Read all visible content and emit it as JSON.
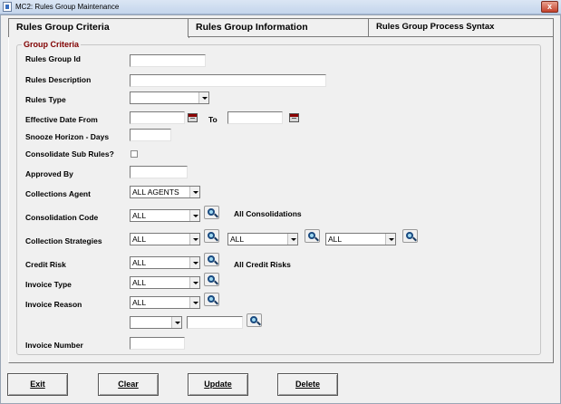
{
  "window": {
    "title": "MC2: Rules Group Maintenance",
    "close_label": "x"
  },
  "tabs": [
    {
      "label": "Rules Group Criteria",
      "active": true
    },
    {
      "label": "Rules Group Information",
      "active": false
    },
    {
      "label": "Rules Group Process Syntax",
      "active": false
    }
  ],
  "group": {
    "label": "Group Criteria"
  },
  "fields": {
    "rules_group_id": {
      "label": "Rules Group Id",
      "value": ""
    },
    "rules_description": {
      "label": "Rules Description",
      "value": ""
    },
    "rules_type": {
      "label": "Rules Type",
      "value": ""
    },
    "effective_date": {
      "label": "Effective Date From",
      "to_label": "To",
      "from_value": "",
      "to_value": ""
    },
    "snooze": {
      "label": "Snooze Horizon - Days",
      "value": ""
    },
    "consolidate": {
      "label": "Consolidate Sub Rules?",
      "checked": false
    },
    "approved_by": {
      "label": "Approved By",
      "value": ""
    },
    "collections_agent": {
      "label": "Collections Agent",
      "value": "ALL AGENTS"
    },
    "consolidation_code": {
      "label": "Consolidation Code",
      "value": "ALL",
      "note": "All Consolidations"
    },
    "collection_strategies": {
      "label": "Collection Strategies",
      "values": [
        "ALL",
        "ALL",
        "ALL"
      ]
    },
    "credit_risk": {
      "label": "Credit Risk",
      "value": "ALL",
      "note": "All Credit Risks"
    },
    "invoice_type": {
      "label": "Invoice Type",
      "value": "ALL"
    },
    "invoice_reason": {
      "label": "Invoice Reason",
      "value": "ALL"
    },
    "extra": {
      "combo_value": "",
      "text_value": ""
    },
    "invoice_number": {
      "label": "Invoice Number",
      "value": ""
    }
  },
  "buttons": {
    "exit": "Exit",
    "clear": "Clear",
    "update": "Update",
    "delete": "Delete"
  }
}
